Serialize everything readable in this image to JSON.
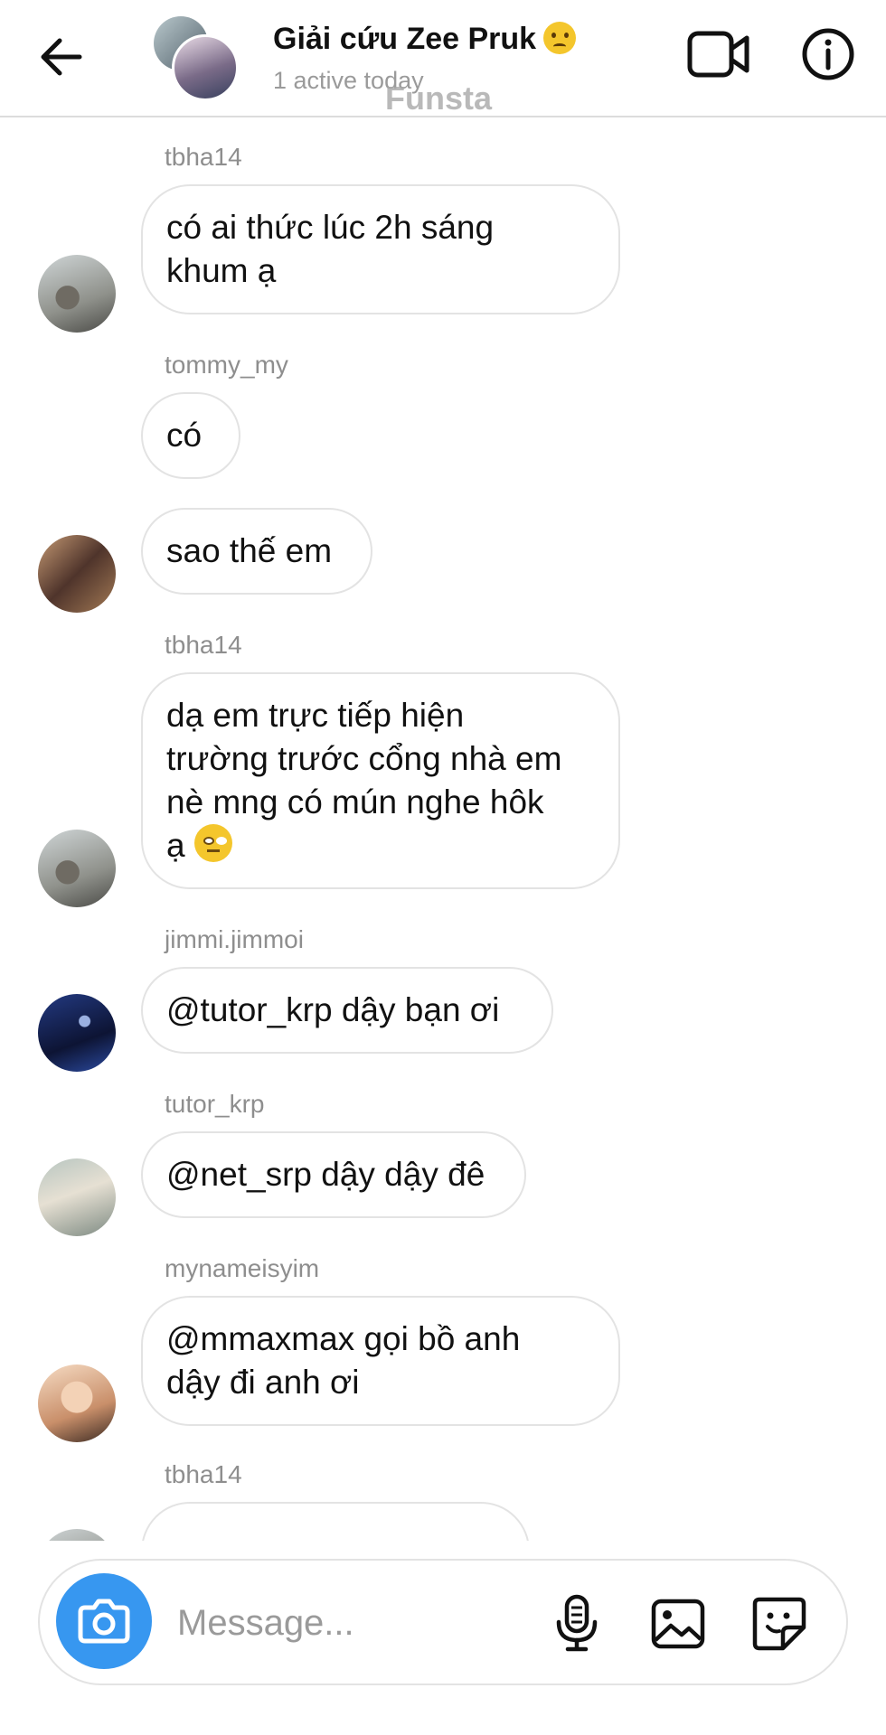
{
  "header": {
    "title": "Giải cứu Zee Pruk",
    "title_emoji": "smiling-face-with-tear",
    "subtitle": "1 active today",
    "watermark": "Funsta",
    "icons": [
      "back-arrow-icon",
      "video-call-icon",
      "info-icon"
    ]
  },
  "messages": [
    {
      "sender": "tbha14",
      "lines": [
        "có ai thức lúc 2h sáng",
        "khum ạ"
      ],
      "avatar": "cat"
    },
    {
      "sender": "tommy_my",
      "lines": [
        "có"
      ],
      "avatar": ""
    },
    {
      "sender": "",
      "lines": [
        "sao thế em"
      ],
      "avatar": "tommy"
    },
    {
      "sender": "tbha14",
      "lines": [
        "dạ em trực tiếp hiện",
        "trường trước cổng nhà em",
        "nè mng có mún nghe hôk",
        "ạ"
      ],
      "emoji": "face-with-rolling-eyes",
      "avatar": "cat"
    },
    {
      "sender": "jimmi.jimmoi",
      "lines": [
        "@tutor_krp dậy bạn ơi"
      ],
      "avatar": "jimmi"
    },
    {
      "sender": "tutor_krp",
      "lines": [
        "@net_srp dậy dậy đê"
      ],
      "avatar": "tutor"
    },
    {
      "sender": "mynameisyim",
      "lines": [
        "@mmaxmax gọi bồ anh",
        "dậy đi anh ơi"
      ],
      "avatar": "mynameisyim"
    },
    {
      "sender": "tbha14",
      "lines": [],
      "avatar": "cat"
    }
  ],
  "composer": {
    "placeholder": "Message...",
    "icons": [
      "camera-icon",
      "microphone-icon",
      "gallery-icon",
      "sticker-icon"
    ],
    "accent_color": "#3797f0"
  },
  "colors": {
    "bubble_border": "#e3e3e3",
    "sender_text": "#8e8e8e",
    "background": "#ffffff"
  }
}
